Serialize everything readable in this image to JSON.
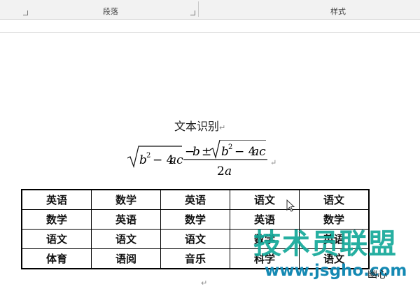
{
  "ribbon": {
    "paragraph_label": "段落",
    "styles_label": "样式"
  },
  "document": {
    "title": "文本识别",
    "paragraph_mark": "↵",
    "table": {
      "rows": [
        [
          "英语",
          "数学",
          "英语",
          "语文",
          "语文"
        ],
        [
          "数学",
          "英语",
          "数学",
          "英语",
          "数学"
        ],
        [
          "语文",
          "语文",
          "语文",
          "数学",
          "英语"
        ],
        [
          "体育",
          "语阅",
          "音乐",
          "科学",
          "语文"
        ]
      ]
    }
  },
  "watermark": {
    "main_text": "技术员联盟",
    "url": "www.jsgho.com",
    "side_text": "幽心"
  },
  "icons": [
    "dialog-launcher-icon",
    "mouse-cursor-icon",
    "paragraph-mark-icon"
  ]
}
